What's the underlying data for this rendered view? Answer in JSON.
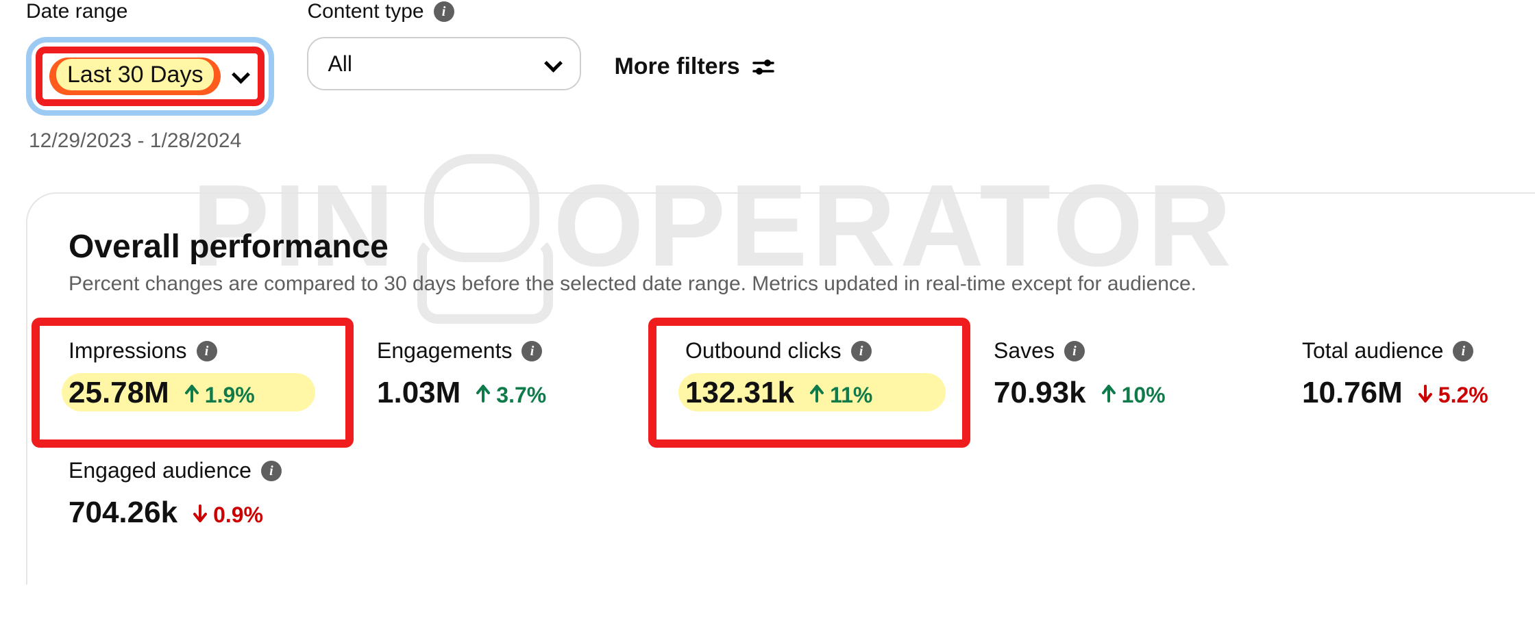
{
  "filters": {
    "date_range": {
      "label": "Date range",
      "value": "Last 30 Days",
      "range_text": "12/29/2023 - 1/28/2024"
    },
    "content_type": {
      "label": "Content type",
      "value": "All"
    },
    "more_filters_label": "More filters"
  },
  "panel": {
    "title": "Overall performance",
    "subtitle": "Percent changes are compared to 30 days before the selected date range. Metrics updated in real-time except for audience."
  },
  "metrics": [
    {
      "key": "impressions",
      "label": "Impressions",
      "value": "25.78M",
      "change": "1.9%",
      "direction": "up",
      "highlighted": true,
      "boxed": true
    },
    {
      "key": "engagements",
      "label": "Engagements",
      "value": "1.03M",
      "change": "3.7%",
      "direction": "up",
      "highlighted": false,
      "boxed": false
    },
    {
      "key": "outbound_clicks",
      "label": "Outbound clicks",
      "value": "132.31k",
      "change": "11%",
      "direction": "up",
      "highlighted": true,
      "boxed": true
    },
    {
      "key": "saves",
      "label": "Saves",
      "value": "70.93k",
      "change": "10%",
      "direction": "up",
      "highlighted": false,
      "boxed": false
    },
    {
      "key": "total_audience",
      "label": "Total audience",
      "value": "10.76M",
      "change": "5.2%",
      "direction": "down",
      "highlighted": false,
      "boxed": false
    },
    {
      "key": "engaged_audience",
      "label": "Engaged audience",
      "value": "704.26k",
      "change": "0.9%",
      "direction": "down",
      "highlighted": false,
      "boxed": false
    }
  ],
  "watermark": {
    "left": "PIN",
    "right": "OPERATOR"
  },
  "colors": {
    "up": "#0f7b4a",
    "down": "#cc0000",
    "highlight": "#fff6a6",
    "red_box": "#ef1d1d",
    "select_blue": "#9ccaf3",
    "highlight_orange": "#ff5b1c"
  }
}
